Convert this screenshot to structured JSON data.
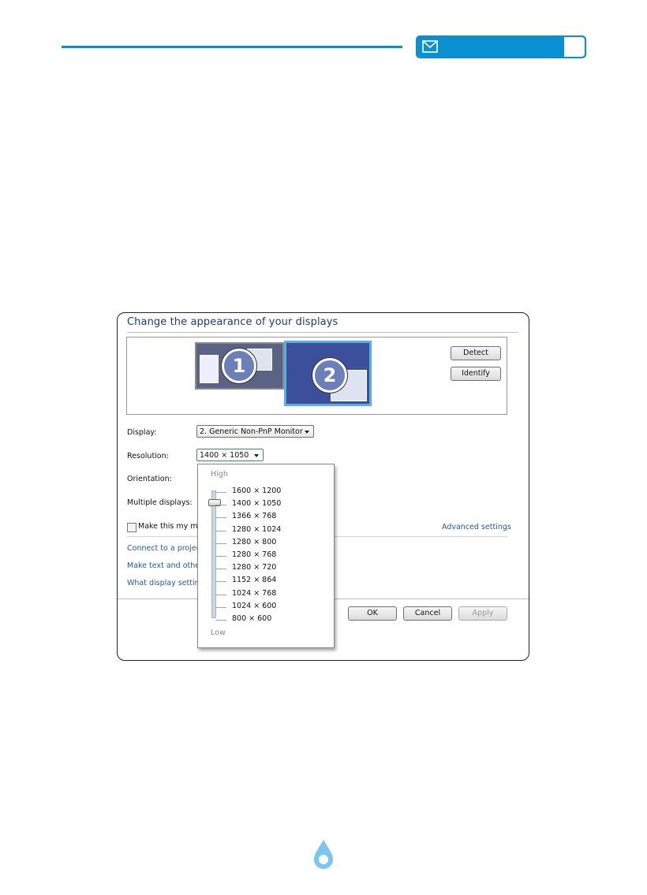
{
  "header": {
    "mail_icon": "mail-icon"
  },
  "dialog": {
    "title": "Change the appearance of your displays",
    "monitors": [
      "1",
      "2"
    ],
    "detect_label": "Detect",
    "identify_label": "Identify",
    "display_label": "Display:",
    "display_value": "2. Generic Non-PnP Monitor",
    "resolution_label": "Resolution:",
    "resolution_value": "1400 × 1050",
    "orientation_label": "Orientation:",
    "multiple_label": "Multiple displays:",
    "make_main_label": "Make this my ma",
    "advanced_link": "Advanced settings",
    "links": [
      "Connect to a projec",
      "Make text and other",
      "What display setting"
    ],
    "ok_label": "OK",
    "cancel_label": "Cancel",
    "apply_label": "Apply"
  },
  "dropdown": {
    "high_label": "High",
    "low_label": "Low",
    "options": [
      "1600 × 1200",
      "1400 × 1050",
      "1366 × 768",
      "1280 × 1024",
      "1280 × 800",
      "1280 × 768",
      "1280 × 720",
      "1152 × 864",
      "1024 × 768",
      "1024 × 600",
      "800 × 600"
    ],
    "selected_index": 1
  },
  "colors": {
    "accent": "#0a8fd0",
    "link": "#1f5ab0",
    "title": "#1a3a8a"
  }
}
